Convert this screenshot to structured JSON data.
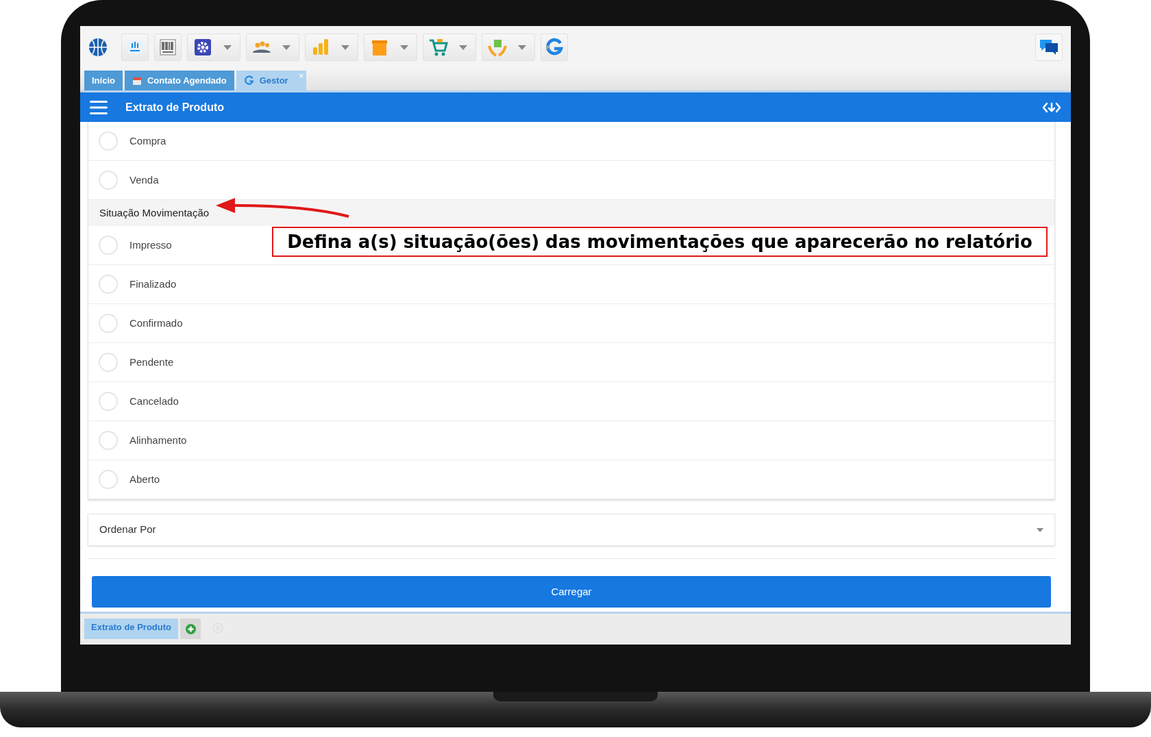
{
  "toolbar": {
    "items": [
      {
        "kind": "logo"
      },
      {
        "kind": "store"
      },
      {
        "kind": "barcode"
      },
      {
        "kind": "gear"
      },
      {
        "kind": "people"
      },
      {
        "kind": "chart"
      },
      {
        "kind": "box"
      },
      {
        "kind": "cart"
      },
      {
        "kind": "hands"
      },
      {
        "kind": "refresh"
      }
    ]
  },
  "tabs": [
    {
      "label": "Início",
      "selected": false
    },
    {
      "label": "Contato Agendado",
      "selected": false
    },
    {
      "label": "Gestor",
      "selected": true,
      "close": "×"
    }
  ],
  "header": {
    "title": "Extrato de Produto"
  },
  "options": [
    {
      "kind": "radio",
      "label": "Compra",
      "checked": false
    },
    {
      "kind": "radio",
      "label": "Venda",
      "checked": false
    },
    {
      "kind": "section",
      "label": "Situação Movimentação"
    },
    {
      "kind": "radio",
      "label": "Impresso",
      "checked": false
    },
    {
      "kind": "radio",
      "label": "Finalizado",
      "checked": false
    },
    {
      "kind": "radio",
      "label": "Confirmado",
      "checked": false
    },
    {
      "kind": "radio",
      "label": "Pendente",
      "checked": false
    },
    {
      "kind": "radio",
      "label": "Cancelado",
      "checked": false
    },
    {
      "kind": "radio",
      "label": "Alinhamento",
      "checked": false
    },
    {
      "kind": "radio",
      "label": "Aberto",
      "checked": false
    }
  ],
  "sort": {
    "placeholder": "Ordenar Por"
  },
  "load_button": "Carregar",
  "annotation": "Defina a(s) situação(ões) das movimentações que aparecerão no relatório",
  "footer_tabs": [
    {
      "label": "Extrato de Produto",
      "selected": true
    }
  ]
}
